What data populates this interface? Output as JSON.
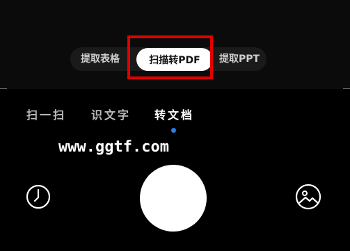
{
  "mode_switcher": {
    "items": [
      "提取表格",
      "扫描转PDF",
      "提取PPT"
    ],
    "selected": "扫描转PDF"
  },
  "tabs": {
    "items": [
      "扫一扫",
      "识文字",
      "转文档"
    ],
    "selected": "转文档"
  },
  "watermark": "www.ggtf.com",
  "bottom_bar": {
    "left_icon": "clock-icon",
    "center": "shutter-button",
    "right_icon": "gallery-icon"
  },
  "colors": {
    "highlight": "#e00000",
    "tab_indicator": "#2b7de9"
  }
}
